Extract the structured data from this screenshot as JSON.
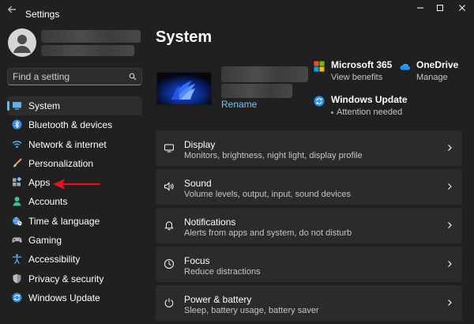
{
  "window": {
    "title": "Settings"
  },
  "search": {
    "placeholder": "Find a setting"
  },
  "sidebar": {
    "items": [
      {
        "id": "system",
        "label": "System",
        "icon": "system-icon",
        "active": true
      },
      {
        "id": "bluetooth",
        "label": "Bluetooth & devices",
        "icon": "bluetooth-icon"
      },
      {
        "id": "network",
        "label": "Network & internet",
        "icon": "wifi-icon"
      },
      {
        "id": "personalization",
        "label": "Personalization",
        "icon": "brush-icon"
      },
      {
        "id": "apps",
        "label": "Apps",
        "icon": "apps-icon"
      },
      {
        "id": "accounts",
        "label": "Accounts",
        "icon": "person-icon"
      },
      {
        "id": "time",
        "label": "Time & language",
        "icon": "globe-clock-icon"
      },
      {
        "id": "gaming",
        "label": "Gaming",
        "icon": "gamepad-icon"
      },
      {
        "id": "accessibility",
        "label": "Accessibility",
        "icon": "accessibility-icon"
      },
      {
        "id": "privacy",
        "label": "Privacy & security",
        "icon": "shield-icon"
      },
      {
        "id": "update",
        "label": "Windows Update",
        "icon": "sync-icon"
      }
    ]
  },
  "main": {
    "title": "System",
    "device": {
      "rename_label": "Rename"
    },
    "quick": {
      "m365": {
        "title": "Microsoft 365",
        "subtitle": "View benefits"
      },
      "onedrive": {
        "title": "OneDrive",
        "subtitle": "Manage"
      },
      "update": {
        "title": "Windows Update",
        "subtitle": "Attention needed"
      }
    },
    "cards": [
      {
        "title": "Display",
        "subtitle": "Monitors, brightness, night light, display profile",
        "icon": "monitor-icon"
      },
      {
        "title": "Sound",
        "subtitle": "Volume levels, output, input, sound devices",
        "icon": "speaker-icon"
      },
      {
        "title": "Notifications",
        "subtitle": "Alerts from apps and system, do not disturb",
        "icon": "bell-icon"
      },
      {
        "title": "Focus",
        "subtitle": "Reduce distractions",
        "icon": "focus-icon"
      },
      {
        "title": "Power & battery",
        "subtitle": "Sleep, battery usage, battery saver",
        "icon": "power-icon"
      }
    ]
  },
  "colors": {
    "background": "#202020",
    "card": "#2b2b2b",
    "accent": "#4cc2ff",
    "link": "#77c4f5",
    "annotation_arrow": "#e81123"
  }
}
